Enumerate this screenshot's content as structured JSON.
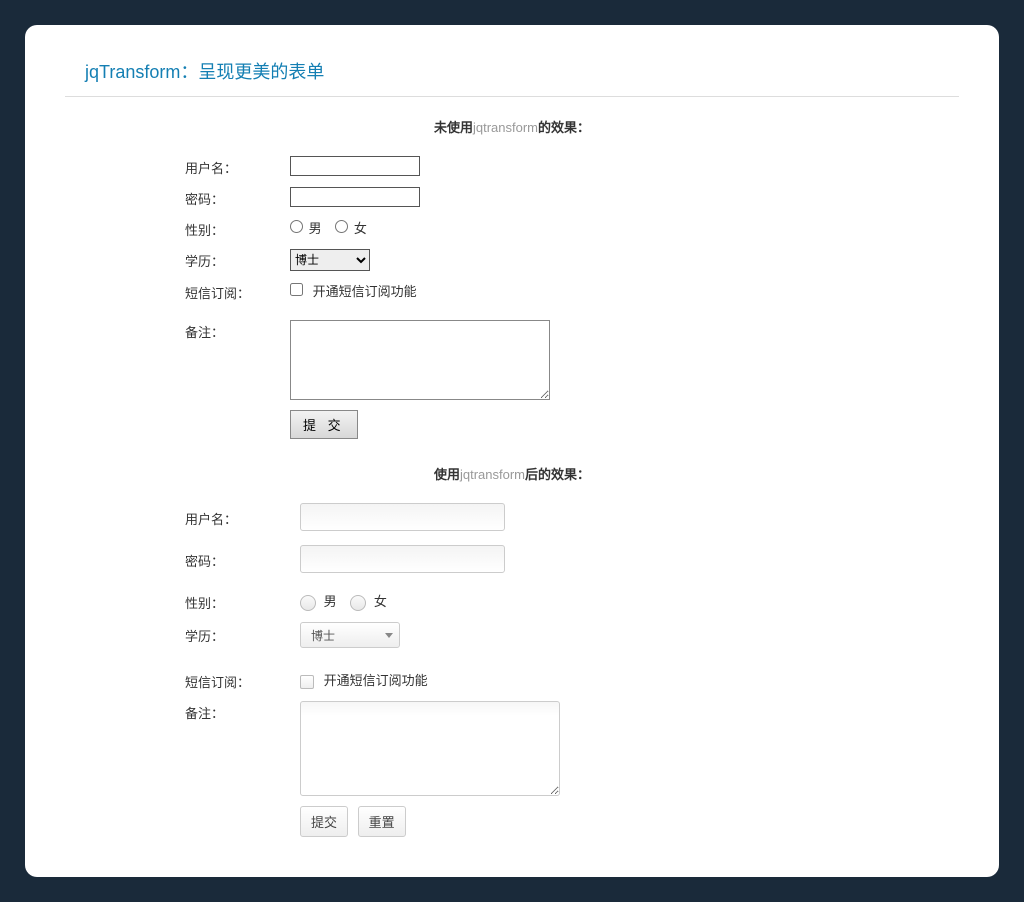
{
  "page_title": "jqTransform：呈现更美的表单",
  "heading1": {
    "pre": "未使用",
    "lib": "jqtransform",
    "post": "的效果："
  },
  "heading2": {
    "pre": "使用",
    "lib": "jqtransform",
    "post": "后的效果："
  },
  "labels": {
    "username": "用户名：",
    "password": "密码：",
    "gender": "性别：",
    "education": "学历：",
    "sms": "短信订阅：",
    "remark": "备注："
  },
  "gender_options": {
    "male": "男",
    "female": "女"
  },
  "education_selected": "博士",
  "sms_checkbox_label": "开通短信订阅功能",
  "buttons": {
    "submit_spaced": "提 交",
    "submit": "提交",
    "reset": "重置"
  }
}
